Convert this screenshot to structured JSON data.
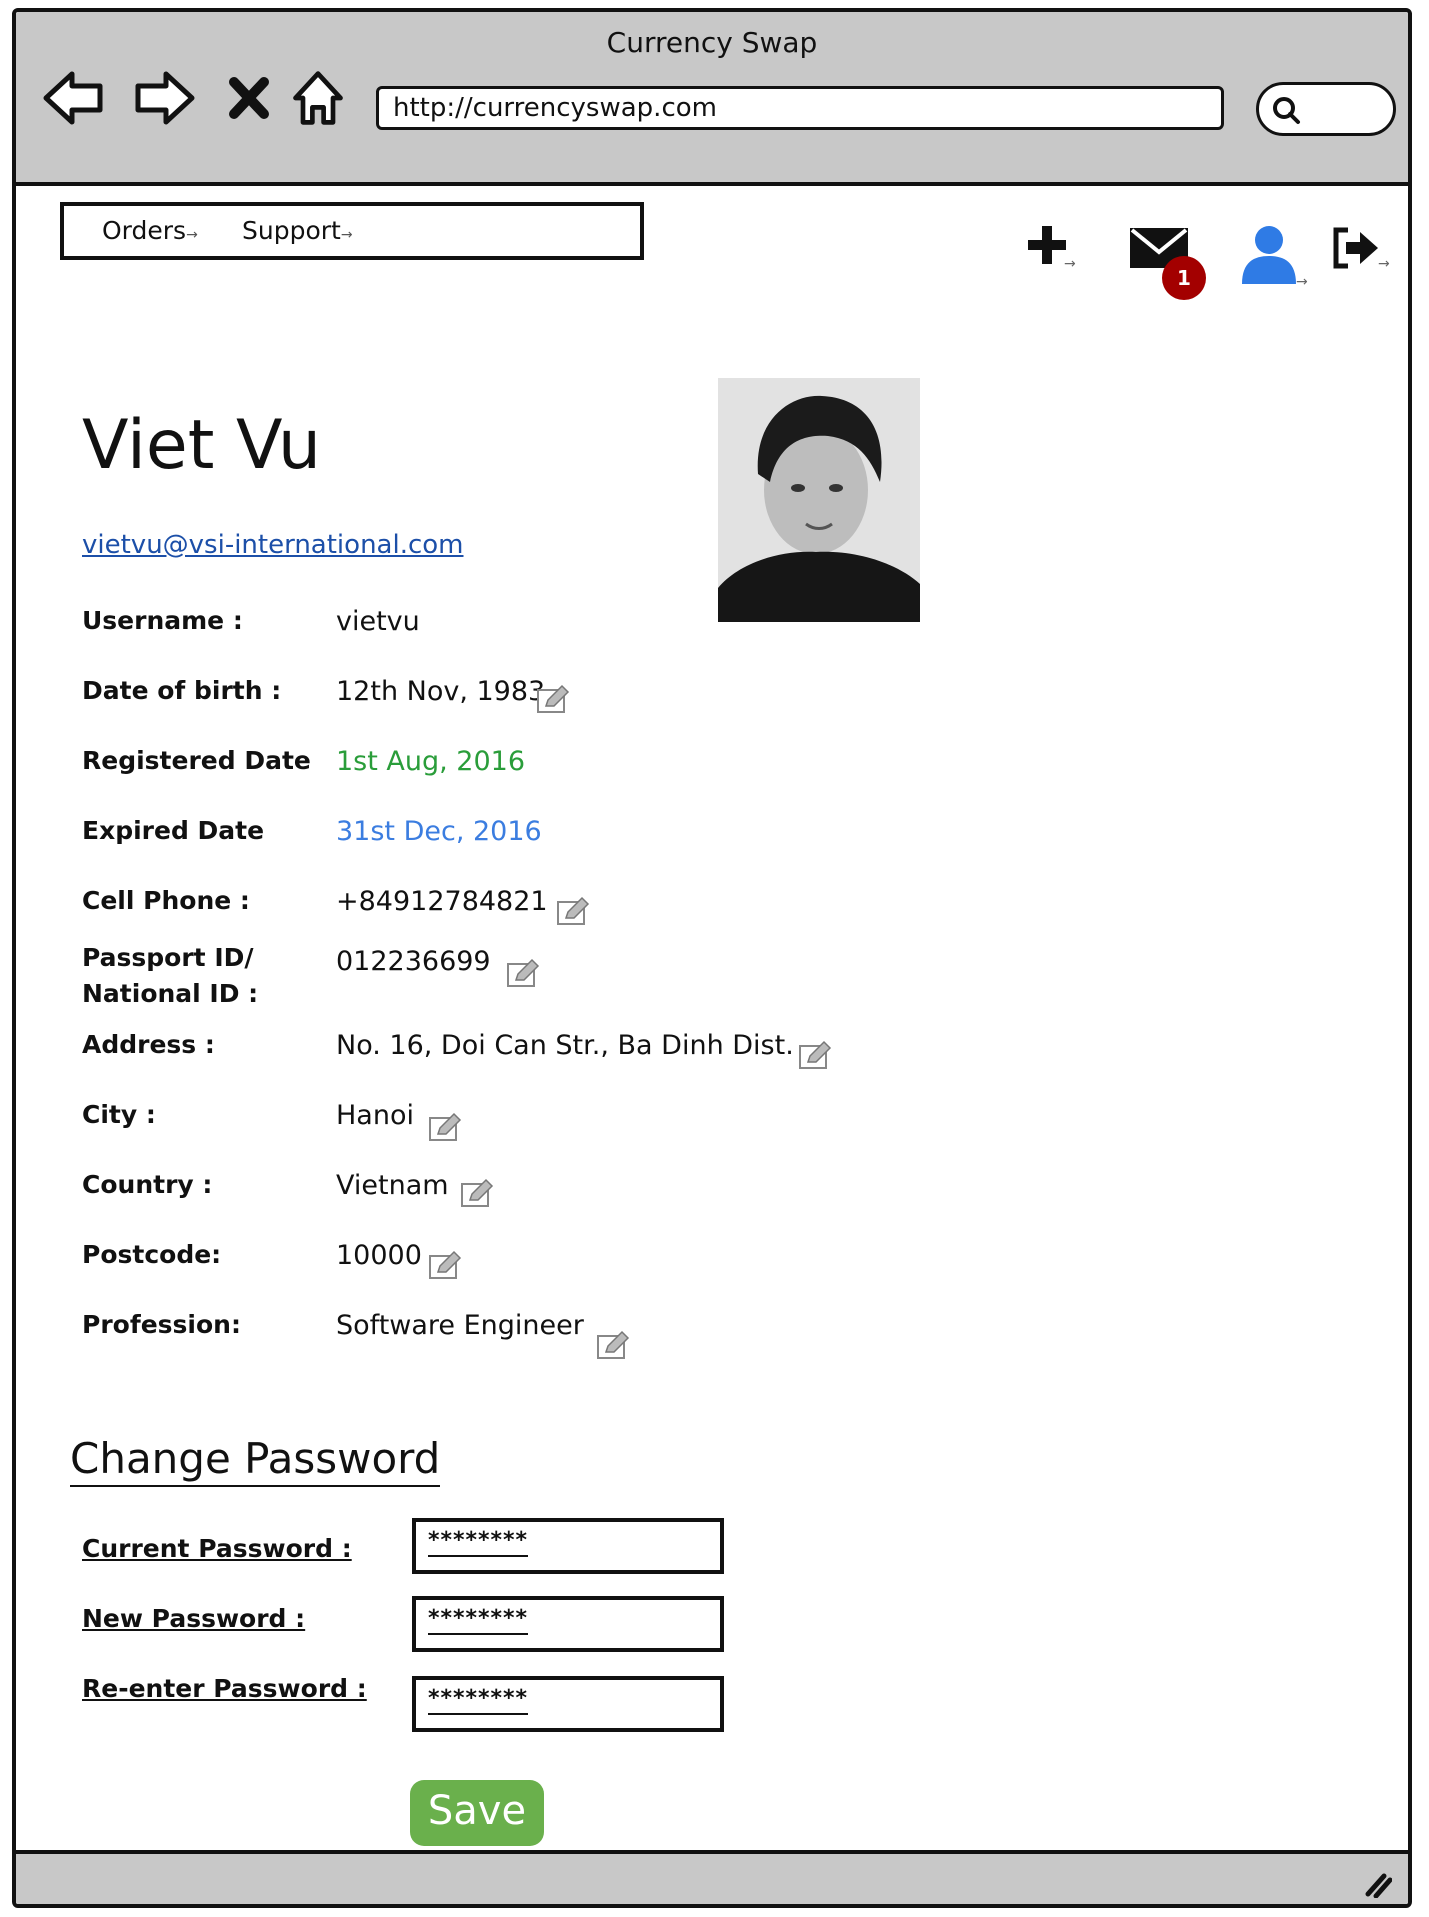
{
  "browser": {
    "title": "Currency Swap",
    "url": "http://currencyswap.com"
  },
  "menu": {
    "orders": "Orders",
    "support": "Support"
  },
  "notifications": {
    "count": "1"
  },
  "profile": {
    "name": "Viet Vu",
    "email": "vietvu@vsi-international.com",
    "fields": {
      "username_label": "Username :",
      "username": "vietvu",
      "dob_label": "Date of birth :",
      "dob": "12th Nov, 1983",
      "registered_label": "Registered Date",
      "registered": "1st Aug, 2016",
      "expired_label": "Expired Date",
      "expired": "31st Dec, 2016",
      "phone_label": "Cell Phone :",
      "phone": "+84912784821",
      "passport_label_1": "Passport ID/",
      "passport_label_2": "National ID :",
      "passport": "012236699",
      "address_label": "Address :",
      "address": "No. 16, Doi Can Str., Ba Dinh Dist.",
      "city_label": "City :",
      "city": "Hanoi",
      "country_label": "Country :",
      "country": "Vietnam",
      "postcode_label": "Postcode:",
      "postcode": "10000",
      "profession_label": "Profession:",
      "profession": "Software Engineer"
    },
    "colors": {
      "registered": "#2a9d3a",
      "expired": "#3b7de0",
      "link": "#1c4fa8"
    }
  },
  "change_password": {
    "title": "Change Password",
    "current_label": "Current Password :",
    "current_value": "********",
    "new_label": "New Password :",
    "new_value": "********",
    "reenter_label": "Re-enter Password :",
    "reenter_value": "********",
    "save_label": "Save"
  },
  "icons": {
    "back": "back-arrow-icon",
    "forward": "forward-arrow-icon",
    "stop": "close-x-icon",
    "home": "home-icon",
    "search": "search-icon",
    "add": "plus-icon",
    "messages": "envelope-icon",
    "user": "user-icon",
    "logout": "logout-icon",
    "edit": "pencil-edit-icon"
  },
  "accent_colors": {
    "save_button": "#6ab04c",
    "badge": "#a30000",
    "user_icon": "#2f7be5"
  }
}
